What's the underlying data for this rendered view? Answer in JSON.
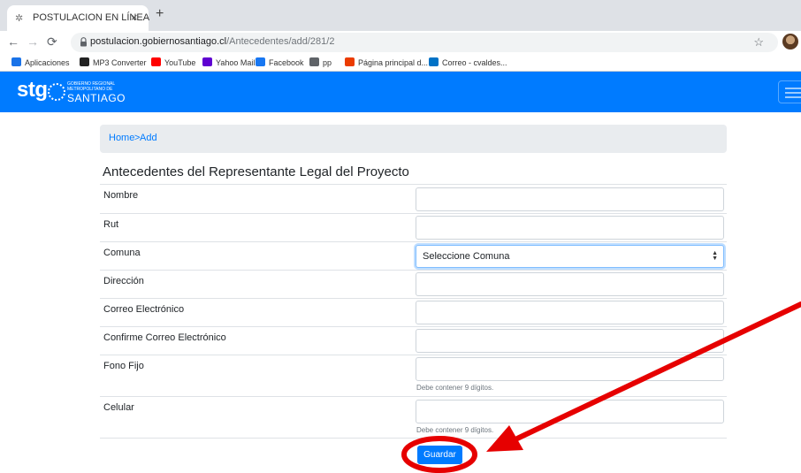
{
  "browser": {
    "tab_title": "POSTULACION EN LÍNEA",
    "tab_close": "×",
    "new_tab": "+",
    "url_host": "postulacion.gobiernosantiago.cl",
    "url_path": "/Antecedentes/add/281/2",
    "bookmarks": [
      {
        "label": "Aplicaciones",
        "icon": "apps-grid-icon",
        "color": "#1a73e8"
      },
      {
        "label": "MP3 Converter",
        "icon": "music-note-icon",
        "color": "#222222"
      },
      {
        "label": "YouTube",
        "icon": "youtube-icon",
        "color": "#ff0000"
      },
      {
        "label": "Yahoo Mail",
        "icon": "yahoo-icon",
        "color": "#5f01d1"
      },
      {
        "label": "Facebook",
        "icon": "facebook-icon",
        "color": "#1877f2"
      },
      {
        "label": "pp",
        "icon": "folder-icon",
        "color": "#5f6368"
      },
      {
        "label": "Página principal d...",
        "icon": "office-icon",
        "color": "#eb3c00"
      },
      {
        "label": "Correo - cvaldes...",
        "icon": "outlook-icon",
        "color": "#0072c6"
      }
    ]
  },
  "header": {
    "logo_text": "stg",
    "logo_line1": "GOBIERNO REGIONAL",
    "logo_line2": "METROPOLITANO DE",
    "logo_line3": "SANTIAGO",
    "brand_color": "#007bff"
  },
  "breadcrumb": {
    "home": "Home",
    "separator": ">",
    "current": "Add"
  },
  "form": {
    "title": "Antecedentes del Representante Legal del Proyecto",
    "fields": [
      {
        "label": "Nombre",
        "value": ""
      },
      {
        "label": "Rut",
        "value": ""
      },
      {
        "label": "Comuna",
        "value": "Seleccione Comuna"
      },
      {
        "label": "Dirección",
        "value": ""
      },
      {
        "label": "Correo Electrónico",
        "value": ""
      },
      {
        "label": "Confirme Correo Electrónico",
        "value": ""
      },
      {
        "label": "Fono Fijo",
        "value": "",
        "help": "Debe contener 9 dígitos."
      },
      {
        "label": "Celular",
        "value": "",
        "help": "Debe contener 9 dígitos."
      }
    ],
    "submit_label": "Guardar"
  },
  "annotation_color": "#e60000"
}
